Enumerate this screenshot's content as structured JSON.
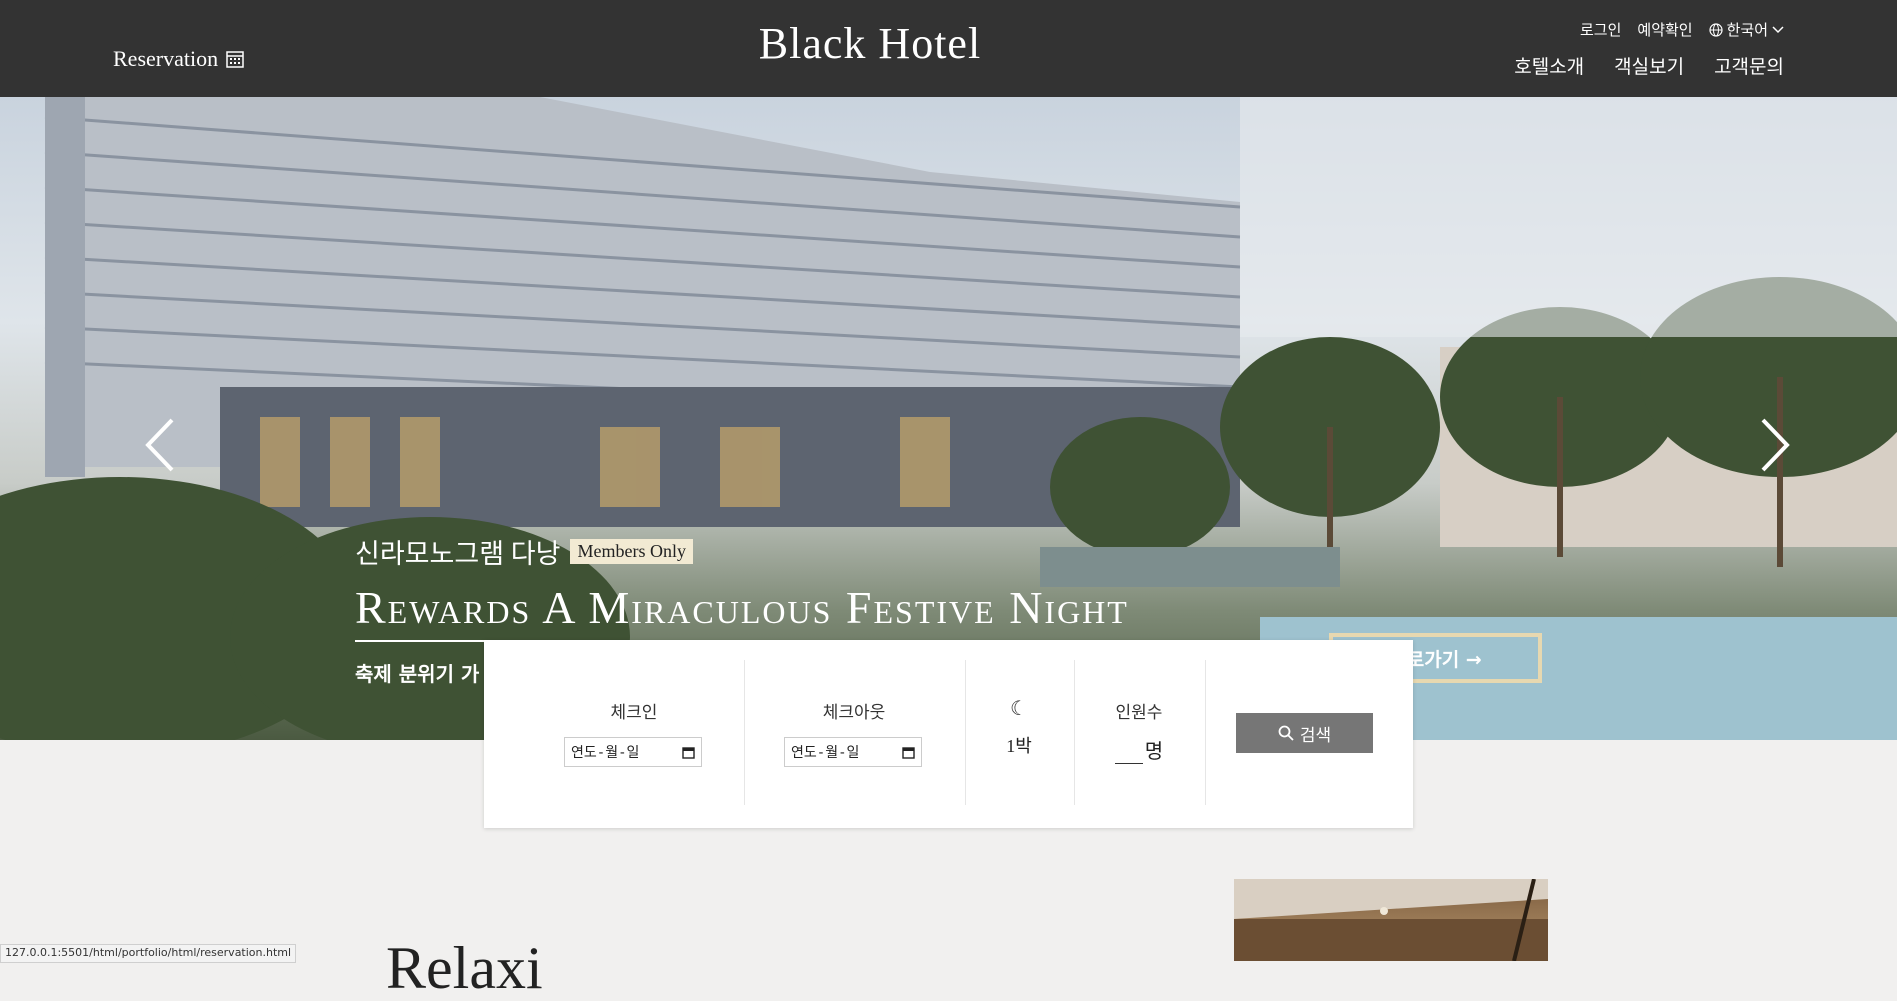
{
  "header": {
    "reservation_label": "Reservation",
    "logo": "Black Hotel",
    "util": {
      "login": "로그인",
      "check_booking": "예약확인",
      "language": "한국어"
    },
    "nav": [
      "호텔소개",
      "객실보기",
      "고객문의"
    ]
  },
  "hero": {
    "promo_sub": "신라모노그램 다낭",
    "badge": "Members Only",
    "promo_title": "Rewards A Miraculous Festive Night",
    "promo_desc": "축제 분위기 가",
    "goto_label": "바로가기 →"
  },
  "booking": {
    "checkin_label": "체크인",
    "checkin_value": "연도-월-일",
    "checkout_label": "체크아웃",
    "checkout_value": "연도-월-일",
    "nights_value": "1박",
    "guests_label": "인원수",
    "guests_unit": "명",
    "search_label": "검색"
  },
  "main": {
    "heading_partial": "Relaxi"
  },
  "status_bar": {
    "url": "127.0.0.1:5501/html/portfolio/html/reservation.html"
  },
  "icons": {
    "calendar": "calendar-icon",
    "globe": "globe-icon",
    "chevron": "chevron-down-icon",
    "moon": "moon-icon",
    "search": "search-icon",
    "prev": "chevron-left-icon",
    "next": "chevron-right-icon"
  },
  "colors": {
    "header_bg": "#333333",
    "search_bg": "#767676",
    "badge_bg": "#f2ead3",
    "goto_border": "#e7d8b0"
  }
}
